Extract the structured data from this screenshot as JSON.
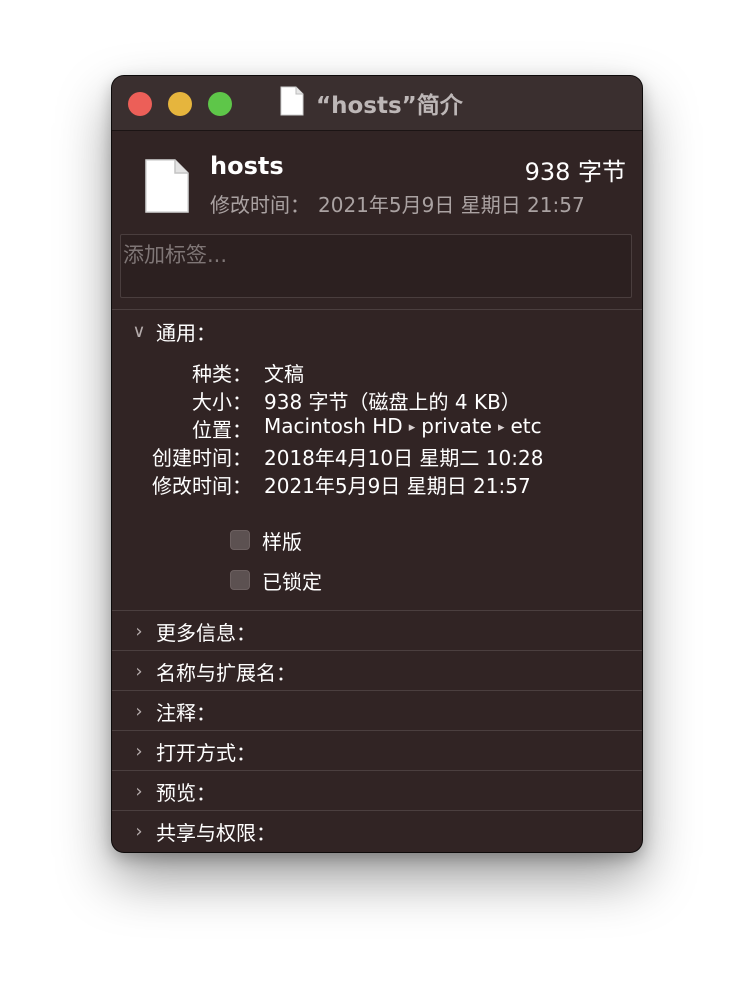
{
  "window": {
    "title": "“hosts”简介",
    "title_icon": "document-icon"
  },
  "header": {
    "file_name": "hosts",
    "file_size": "938 字节",
    "modified_label": "修改时间：",
    "modified_value": "2021年5月9日 星期日 21:57"
  },
  "tags": {
    "placeholder": "添加标签..."
  },
  "general": {
    "title": "通用：",
    "rows": [
      {
        "key": "种类：",
        "value": "文稿"
      },
      {
        "key": "大小：",
        "value": "938 字节（磁盘上的 4 KB）"
      },
      {
        "key": "位置：",
        "parts": [
          "Macintosh HD",
          "private",
          "etc"
        ]
      },
      {
        "key": "创建时间：",
        "value": "2018年4月10日 星期二 10:28"
      },
      {
        "key": "修改时间：",
        "value": "2021年5月9日 星期日 21:57"
      }
    ],
    "stationery_label": "样版",
    "stationery_checked": false,
    "locked_label": "已锁定",
    "locked_checked": false
  },
  "sections": [
    {
      "label": "更多信息："
    },
    {
      "label": "名称与扩展名："
    },
    {
      "label": "注释："
    },
    {
      "label": "打开方式："
    },
    {
      "label": "预览："
    },
    {
      "label": "共享与权限："
    }
  ],
  "colors": {
    "window_bg": "#312424",
    "close": "#ec5f58",
    "minimize": "#e6b53d",
    "zoom": "#5ec649"
  }
}
